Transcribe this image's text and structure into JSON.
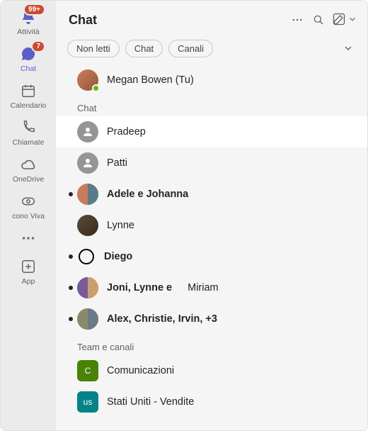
{
  "rail": {
    "items": [
      {
        "key": "activity",
        "label": "Attività",
        "badge": "99+"
      },
      {
        "key": "chat",
        "label": "Chat",
        "badge": "7"
      },
      {
        "key": "calendar",
        "label": "Calendario"
      },
      {
        "key": "calls",
        "label": "Chiamate"
      },
      {
        "key": "onedrive",
        "label": "OneDrive"
      },
      {
        "key": "viva",
        "label": "cono Viva"
      }
    ],
    "app_label": "App"
  },
  "header": {
    "title": "Chat"
  },
  "filters": {
    "unread": "Non letti",
    "chat": "Chat",
    "channels": "Canali"
  },
  "me": {
    "name": "Megan Bowen (Tu)"
  },
  "sections": {
    "chat": "Chat",
    "teams": "Team e canali"
  },
  "chats": [
    {
      "name": "Pradeep",
      "selected": true
    },
    {
      "name": "Patti"
    },
    {
      "name": "Adele e Johanna",
      "unread": true
    },
    {
      "name": "Lynne"
    },
    {
      "name": "Diego",
      "unread": true,
      "ring": true
    },
    {
      "name": "Joni, Lynne e",
      "extra": "Miriam",
      "unread": true
    },
    {
      "name": "Alex, Christie, Irvin, +3",
      "unread": true
    }
  ],
  "channels": [
    {
      "name": "Comunicazioni",
      "initial": "C",
      "color": "#498205"
    },
    {
      "name": "Stati Uniti - Vendite",
      "initial": "us",
      "color": "#038387"
    }
  ]
}
